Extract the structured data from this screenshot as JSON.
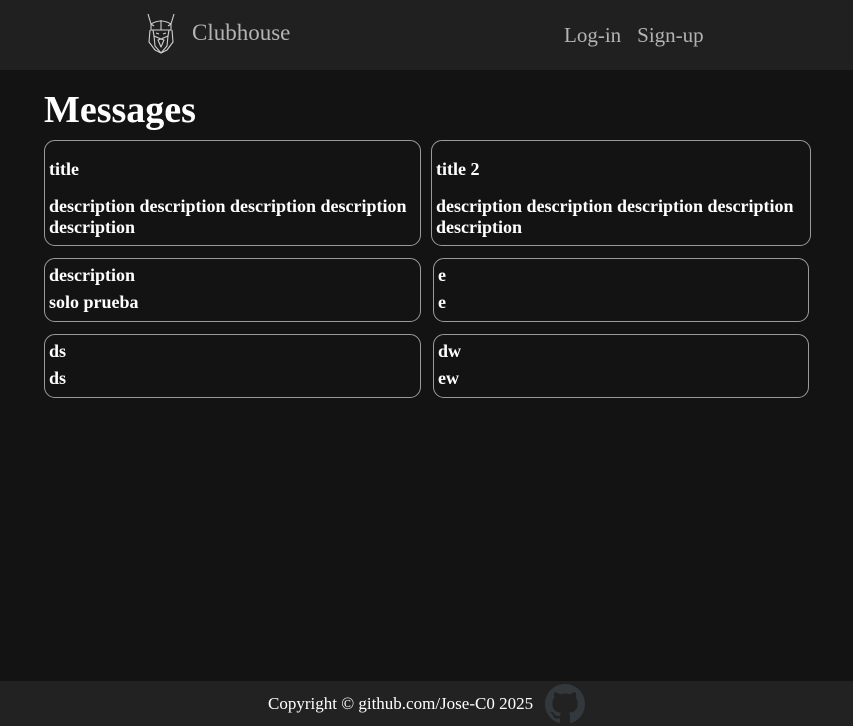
{
  "header": {
    "brand_name": "Clubhouse",
    "logo_icon": "viking-head-icon",
    "nav": {
      "login_label": "Log-in",
      "signup_label": "Sign-up"
    }
  },
  "main": {
    "page_title": "Messages",
    "messages": [
      {
        "title": "title",
        "description": "description description description description description"
      },
      {
        "title": "title 2",
        "description": "description description description description description"
      },
      {
        "title": "description",
        "description": "solo prueba"
      },
      {
        "title": "e",
        "description": "e"
      },
      {
        "title": "ds",
        "description": "ds"
      },
      {
        "title": "dw",
        "description": "ew"
      }
    ]
  },
  "footer": {
    "copyright": "Copyright © github.com/Jose-C0 2025",
    "github_icon": "github-icon"
  },
  "colors": {
    "background": "#131313",
    "header_bg": "#202020",
    "footer_bg": "#222222",
    "nav_text": "#b3b3b3",
    "card_border": "#9a9a9a"
  }
}
